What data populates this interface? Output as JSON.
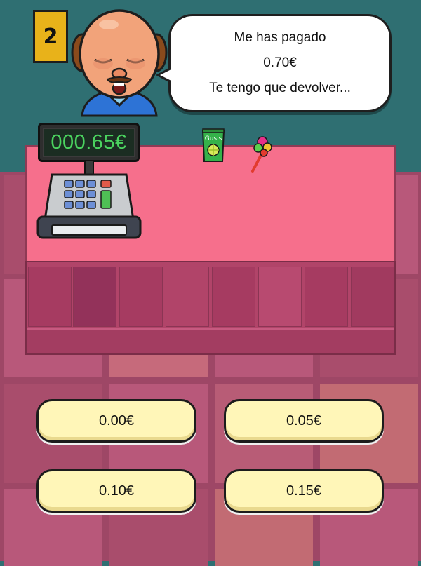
{
  "level": "2",
  "speech": {
    "line1": "Me has pagado",
    "line2": "0.70€",
    "line3": "Te tengo que devolver..."
  },
  "register": {
    "display": "000.65€"
  },
  "items": [
    {
      "name": "Gusis",
      "icon": "candy-bag-icon"
    },
    {
      "name": "",
      "icon": "lollipop-candy-icon"
    }
  ],
  "answers": [
    {
      "label": "0.00€"
    },
    {
      "label": "0.05€"
    },
    {
      "label": "0.10€"
    },
    {
      "label": "0.15€"
    }
  ],
  "colors": {
    "wall": "#2f6f72",
    "counter": "#f66f8c",
    "button": "#fff6b8",
    "display_text": "#4bd35f",
    "badge": "#e8b21a"
  }
}
